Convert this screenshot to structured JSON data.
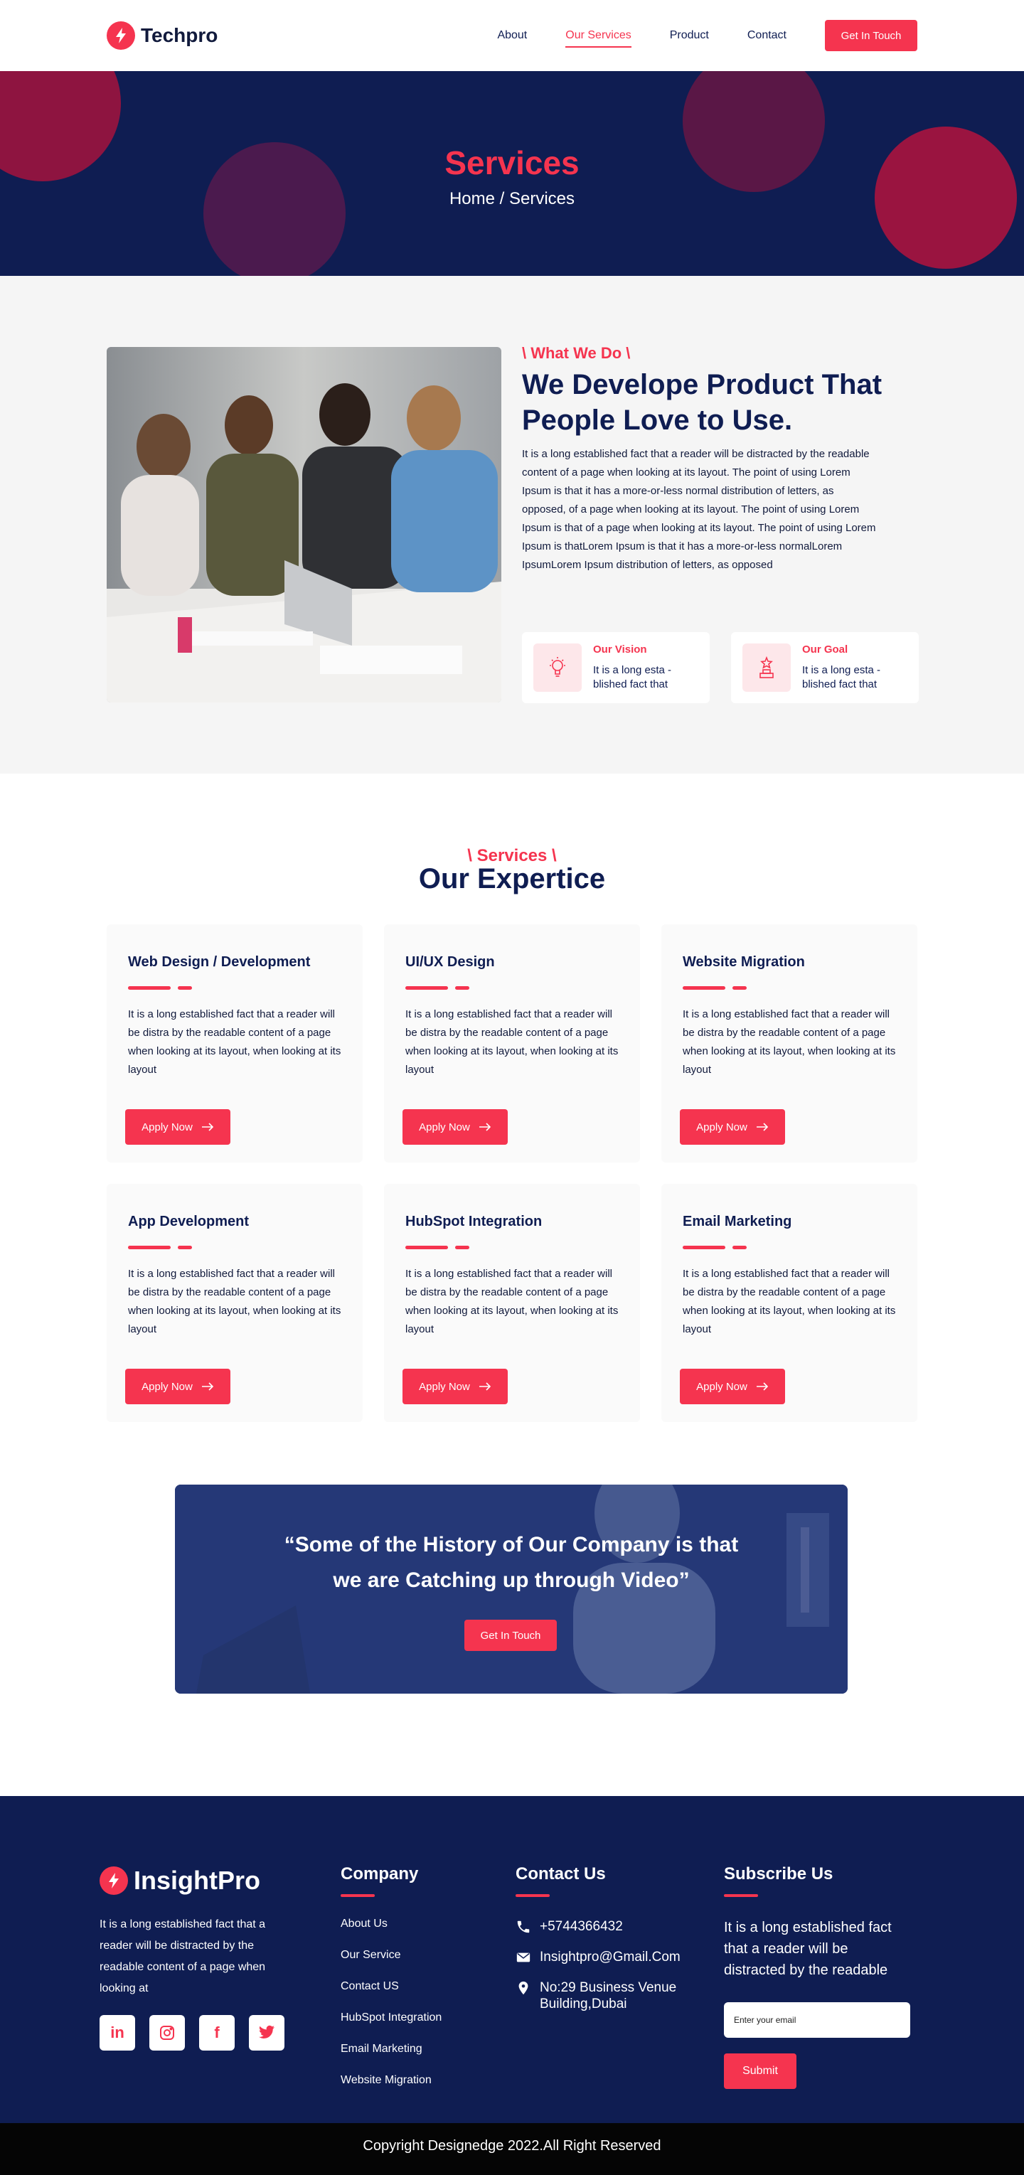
{
  "brand": {
    "name": "Techpro",
    "accent": "#f5344f",
    "navy": "#0f1d52"
  },
  "nav": {
    "links": [
      "About",
      "Our Services",
      "Product",
      "Contact"
    ],
    "active": "Our Services",
    "cta": "Get In Touch"
  },
  "hero": {
    "title": "Services",
    "breadcrumb": "Home / Services"
  },
  "about": {
    "eyebrow": "\\ What We Do \\",
    "heading": "We Develope Product That People Love to Use.",
    "body": "It is a long established fact that a reader will be distracted by the readable content of a page when looking at its layout. The point of using Lorem Ipsum is that it has a more-or-less normal distribution of letters, as opposed,  of a page when looking at its layout. The point of using Lorem Ipsum is that of a page when looking at its layout. The point of using Lorem Ipsum is thatLorem Ipsum is that it has a more-or-less normalLorem IpsumLorem Ipsum distribution of letters, as opposed",
    "features": [
      {
        "title": "Our Vision",
        "text": "It is a long esta -blished fact that",
        "icon": "lightbulb-icon"
      },
      {
        "title": "Our Goal",
        "text": "It is a long esta -blished fact that",
        "icon": "trophy-icon"
      }
    ]
  },
  "services": {
    "eyebrow": "\\ Services \\",
    "heading": "Our Expertice",
    "cards": [
      {
        "title": "Web Design / Development",
        "text": "It is a long established fact that a reader will be distra by the readable content of a page when looking at its layout, when looking at its layout",
        "button": "Apply Now"
      },
      {
        "title": "UI/UX Design",
        "text": "It is a long established fact that a reader will be distra by the readable content of a page when looking at its layout, when looking at its layout",
        "button": "Apply Now"
      },
      {
        "title": "Website Migration",
        "text": "It is a long established fact that a reader will be distra by the readable content of a page when looking at its layout, when looking at its layout",
        "button": "Apply Now"
      },
      {
        "title": "App Development",
        "text": "It is a long established fact that a reader will be distra by the readable content of a page when looking at its layout, when looking at its layout",
        "button": "Apply Now"
      },
      {
        "title": "HubSpot Integration",
        "text": "It is a long established fact that a reader will be distra by the readable content of a page when looking at its layout, when looking at its layout",
        "button": "Apply Now"
      },
      {
        "title": "Email Marketing",
        "text": "It is a long established fact that a reader will be distra by the readable content of a page when looking at its layout, when looking at its layout",
        "button": "Apply Now"
      }
    ]
  },
  "video": {
    "quote_line1": "“Some of the History of Our Company is that",
    "quote_line2": "we are Catching up through Video”",
    "button": "Get In Touch"
  },
  "footer": {
    "brand": "InsightPro",
    "about": "It is a long established fact that a reader will be distracted by the readable content of a page when looking at",
    "socials": [
      "linkedin-icon",
      "instagram-icon",
      "facebook-icon",
      "twitter-icon"
    ],
    "company": {
      "title": "Company",
      "links": [
        "About Us",
        "Our Service",
        "Contact US",
        "HubSpot Integration",
        "Email Marketing",
        "Website Migration"
      ]
    },
    "contact": {
      "title": "Contact Us",
      "phone": "+5744366432",
      "email": "Insightpro@Gmail.Com",
      "address": "No:29 Business Venue Building,Dubai"
    },
    "subscribe": {
      "title": "Subscribe Us",
      "text": "It is a long established fact that a reader will be distracted by the readable",
      "placeholder": "Enter your email",
      "button": "Submit"
    },
    "copyright": "Copyright Designedge 2022.All Right Reserved"
  }
}
